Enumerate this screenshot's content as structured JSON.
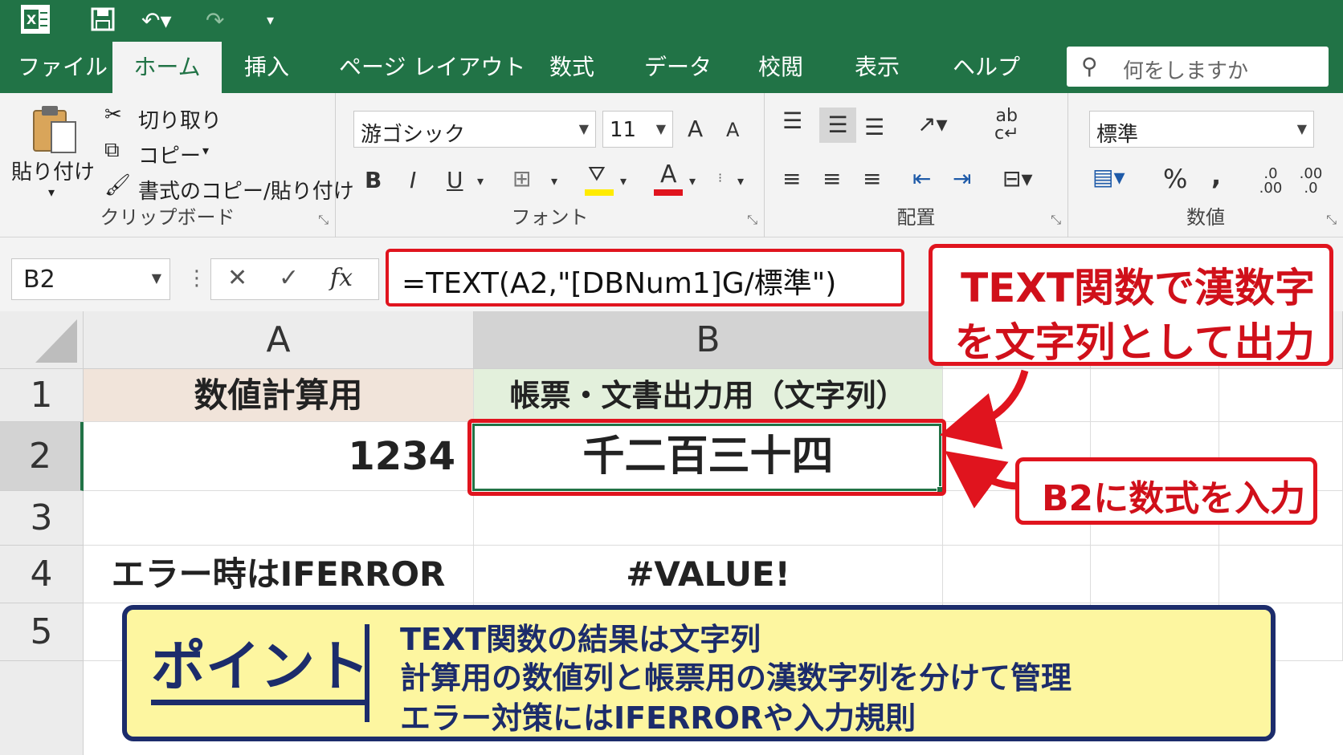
{
  "titlebar": {
    "icons": [
      "excel-icon",
      "save-icon",
      "undo-icon",
      "redo-icon",
      "customize-icon"
    ]
  },
  "tabs": [
    {
      "label": "ファイル",
      "active": false
    },
    {
      "label": "ホーム",
      "active": true
    },
    {
      "label": "挿入",
      "active": false
    },
    {
      "label": "ページ レイアウト",
      "active": false
    },
    {
      "label": "数式",
      "active": false
    },
    {
      "label": "データ",
      "active": false
    },
    {
      "label": "校閲",
      "active": false
    },
    {
      "label": "表示",
      "active": false
    },
    {
      "label": "ヘルプ",
      "active": false
    }
  ],
  "search": {
    "placeholder": "何をしますか"
  },
  "ribbon": {
    "clipboard": {
      "paste": "貼り付け",
      "cut": "切り取り",
      "copy": "コピー",
      "format_painter": "書式のコピー/貼り付け",
      "label": "クリップボード"
    },
    "font": {
      "font_name": "游ゴシック",
      "font_size": "11",
      "grow": "A",
      "shrink": "A",
      "bold": "B",
      "italic": "I",
      "underline": "U",
      "label": "フォント"
    },
    "alignment": {
      "label": "配置"
    },
    "number": {
      "format": "標準",
      "percent": "%",
      "comma": ",",
      "inc_decimal": ".0 .00",
      "dec_decimal": ".00 .0",
      "label": "数値"
    }
  },
  "formula_bar": {
    "name_box": "B2",
    "cancel": "✕",
    "enter": "✓",
    "fx": "fx",
    "formula": "=TEXT(A2,\"[DBNum1]G/標準\")"
  },
  "callouts": {
    "formula_note_line1": "TEXT関数で漢数字",
    "formula_note_line2": "を文字列として出力",
    "cell_note": "B2に数式を入力"
  },
  "sheet": {
    "columns": [
      "A",
      "B"
    ],
    "rows": [
      "1",
      "2",
      "3",
      "4",
      "5"
    ],
    "A1": "数値計算用",
    "B1": "帳票・文書出力用（文字列）",
    "A2": "1234",
    "B2": "千二百三十四",
    "A4": "エラー時はIFERROR",
    "B4": "#VALUE!"
  },
  "point": {
    "title": "ポイント",
    "lines": [
      "TEXT関数の結果は文字列",
      "計算用の数値列と帳票用の漢数字列を分けて管理",
      "エラー対策にはIFERRORや入力規則"
    ]
  },
  "colors": {
    "excel_green": "#217346",
    "callout_red": "#e0141e",
    "point_bg": "#fdf6a0",
    "point_navy": "#1c2c6b",
    "a1_bg": "#f1e4da",
    "b1_bg": "#e3f0dc"
  }
}
